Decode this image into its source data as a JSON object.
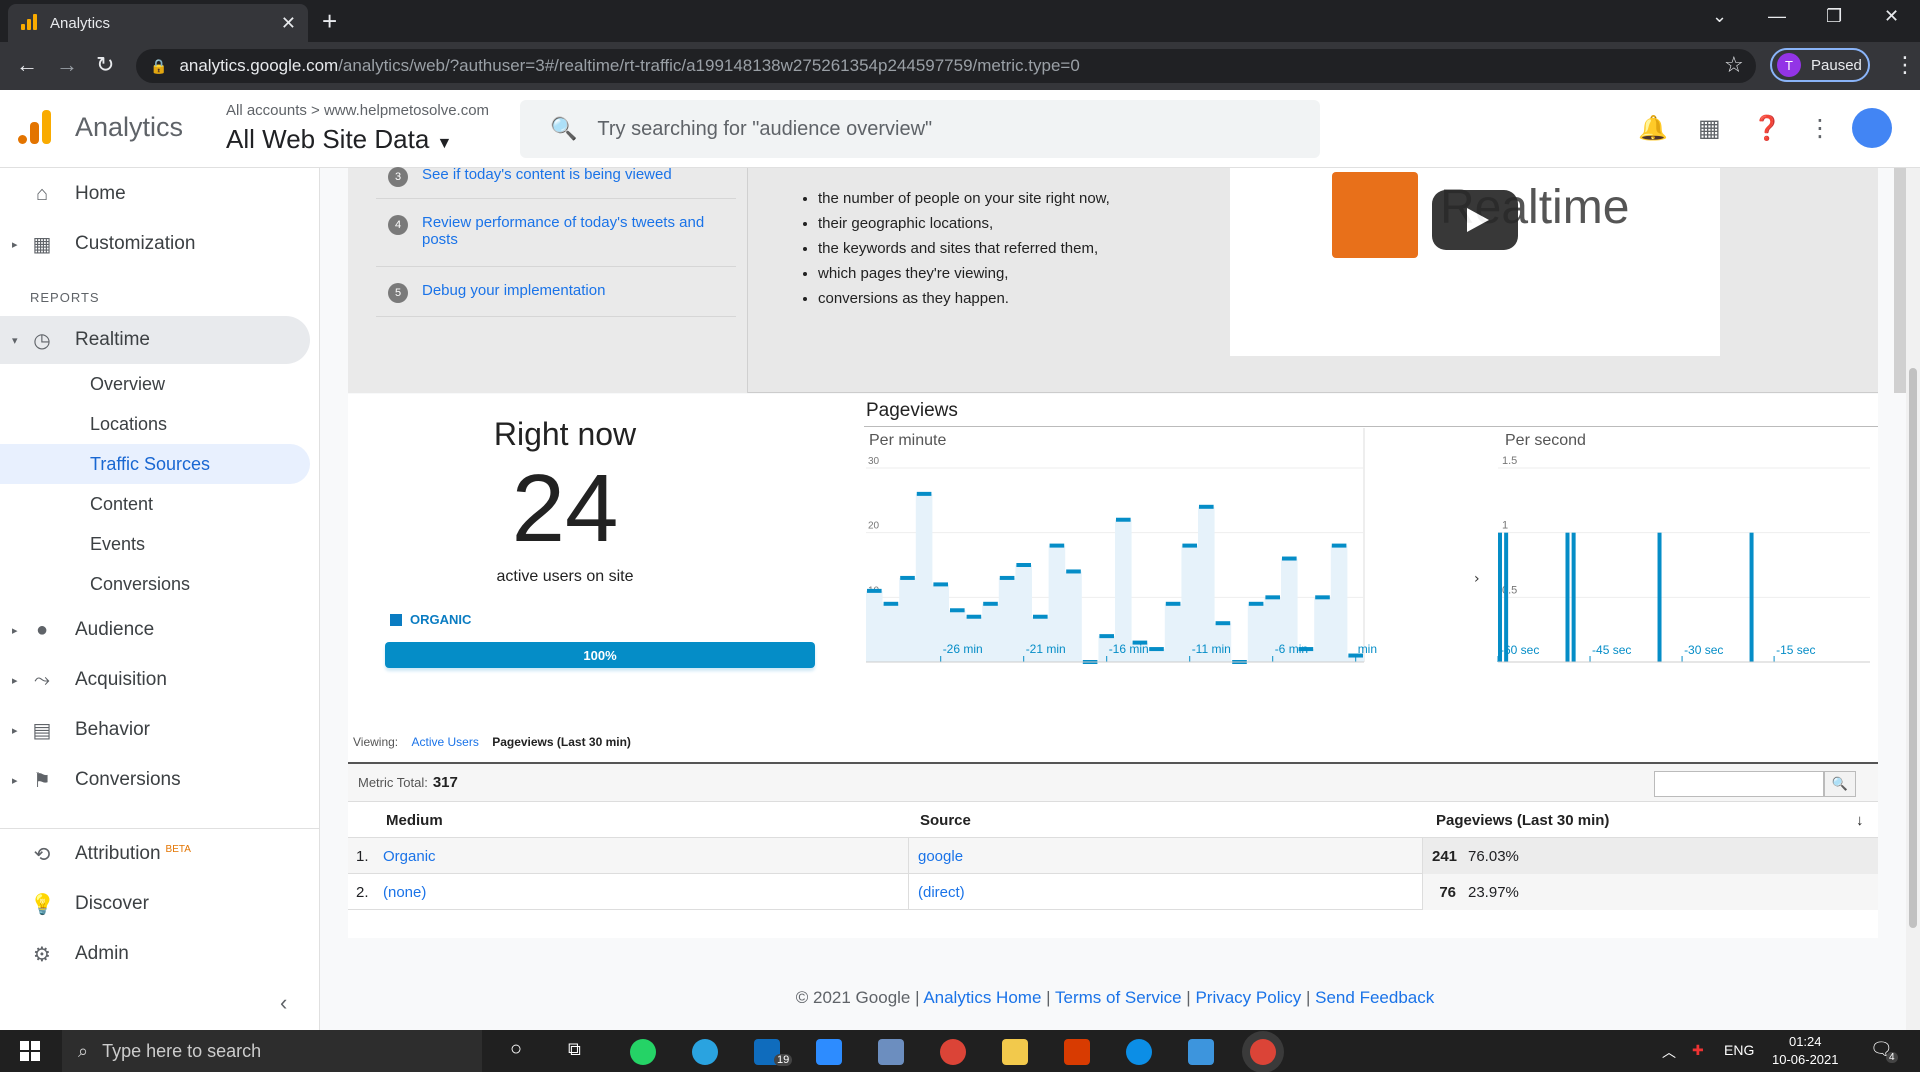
{
  "browser": {
    "tab_title": "Analytics",
    "tab_close": "✕",
    "new_tab": "+",
    "url_host": "analytics.google.com",
    "url_path": "/analytics/web/?authuser=3#/realtime/rt-traffic/a199148138w275261354p244597759/metric.type=0",
    "profile_initial": "T",
    "profile_status": "Paused"
  },
  "header": {
    "app_title": "Analytics",
    "breadcrumb": "All accounts > www.helpmetosolve.com",
    "property": "All Web Site Data",
    "search_placeholder": "Try searching for \"audience overview\""
  },
  "sidebar": {
    "reports_label": "REPORTS",
    "items": [
      {
        "label": "Home",
        "icon": "home-icon"
      },
      {
        "label": "Customization",
        "icon": "dashboard-icon"
      },
      {
        "label": "Realtime",
        "icon": "clock-icon"
      },
      {
        "label": "Audience",
        "icon": "person-icon"
      },
      {
        "label": "Acquisition",
        "icon": "acquisition-icon"
      },
      {
        "label": "Behavior",
        "icon": "behavior-icon"
      },
      {
        "label": "Conversions",
        "icon": "flag-icon"
      },
      {
        "label": "Attribution",
        "icon": "attribution-icon",
        "badge": "BETA"
      },
      {
        "label": "Discover",
        "icon": "lightbulb-icon"
      },
      {
        "label": "Admin",
        "icon": "gear-icon"
      }
    ],
    "realtime_sub": [
      "Overview",
      "Locations",
      "Traffic Sources",
      "Content",
      "Events",
      "Conversions"
    ],
    "selected_sub": "Traffic Sources"
  },
  "intro": {
    "steps": [
      {
        "num": "3",
        "text": "See if today's content is being viewed"
      },
      {
        "num": "4",
        "text": "Review performance of today's tweets and posts"
      },
      {
        "num": "5",
        "text": "Debug your implementation"
      }
    ],
    "bullets": [
      "the number of people on your site right now,",
      "their geographic locations,",
      "the keywords and sites that referred them,",
      "which pages they're viewing,",
      "conversions as they happen."
    ],
    "video_title": "Realtime"
  },
  "rightnow": {
    "title": "Right now",
    "count": "24",
    "subtitle": "active users on site",
    "segment_label": "ORGANIC",
    "segment_pct": "100%",
    "segment_fraction": 1.0
  },
  "pageviews": {
    "title": "Pageviews",
    "per_minute_label": "Per minute",
    "per_second_label": "Per second",
    "viewing_label": "Viewing:",
    "tab_active_users": "Active Users",
    "tab_pageviews": "Pageviews (Last 30 min)"
  },
  "chart_data": [
    {
      "type": "bar",
      "title": "Per minute",
      "ylim": [
        0,
        30
      ],
      "yticks": [
        "10",
        "20",
        "30"
      ],
      "xticks": [
        "-26 min",
        "-21 min",
        "-16 min",
        "-11 min",
        "-6 min",
        "min"
      ],
      "xtick_positions": [
        -26,
        -21,
        -16,
        -11,
        -6,
        -1
      ],
      "x": [
        -30,
        -29,
        -28,
        -27,
        -26,
        -25,
        -24,
        -23,
        -22,
        -21,
        -20,
        -19,
        -18,
        -17,
        -16,
        -15,
        -14,
        -13,
        -12,
        -11,
        -10,
        -9,
        -8,
        -7,
        -6,
        -5,
        -4,
        -3,
        -2,
        -1
      ],
      "values": [
        11,
        9,
        13,
        26,
        12,
        8,
        7,
        9,
        13,
        15,
        7,
        18,
        14,
        0,
        4,
        22,
        3,
        2,
        9,
        18,
        24,
        6,
        0,
        9,
        10,
        16,
        2,
        10,
        18,
        1
      ],
      "color": "#058dc7",
      "fill": "#e6f2fa"
    },
    {
      "type": "bar",
      "title": "Per second",
      "ylim": [
        0,
        1.5
      ],
      "yticks": [
        "0.5",
        "1",
        "1.5"
      ],
      "xticks": [
        "-60 sec",
        "-45 sec",
        "-30 sec",
        "-15 sec"
      ],
      "xtick_positions": [
        -60,
        -45,
        -30,
        -15
      ],
      "x": [
        -60,
        -59,
        -49,
        -48,
        -34,
        -19
      ],
      "values": [
        1,
        1,
        1,
        1,
        1,
        1
      ],
      "color": "#058dc7"
    }
  ],
  "table": {
    "metric_total_label": "Metric Total:",
    "metric_total": "317",
    "columns": [
      "Medium",
      "Source",
      "Pageviews (Last 30 min)"
    ],
    "rows": [
      {
        "idx": "1.",
        "medium": "Organic",
        "source": "google",
        "value": "241",
        "pct": "76.03%"
      },
      {
        "idx": "2.",
        "medium": "(none)",
        "source": "(direct)",
        "value": "76",
        "pct": "23.97%"
      }
    ]
  },
  "footer": {
    "copyright": "© 2021 Google",
    "links": [
      "Analytics Home",
      "Terms of Service",
      "Privacy Policy",
      "Send Feedback"
    ]
  },
  "taskbar": {
    "search_placeholder": "Type here to search",
    "lang": "ENG",
    "time": "01:24",
    "date": "10-06-2021",
    "mail_badge": "19",
    "notif_badge": "4"
  }
}
